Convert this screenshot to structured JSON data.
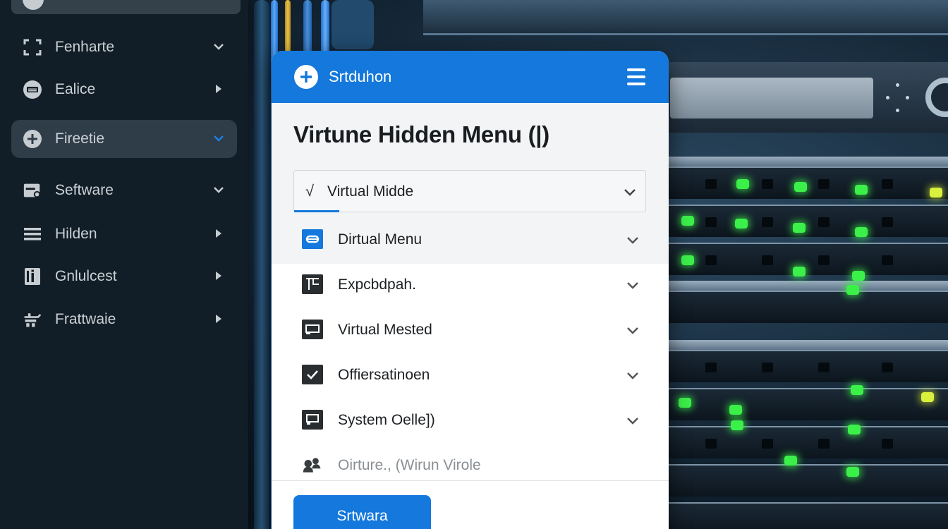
{
  "sidebar": {
    "items": [
      {
        "label": "Fenharte",
        "icon": "frame-icon",
        "indicator": "chevron-down"
      },
      {
        "label": "Ealice",
        "icon": "keyboard-icon",
        "indicator": "caret-right"
      },
      {
        "label": "Fireetie",
        "icon": "plus-circle-icon",
        "indicator": "chevron-down",
        "active": true
      },
      {
        "label": "Seftware",
        "icon": "calendar-icon",
        "indicator": "chevron-down"
      },
      {
        "label": "Hilden",
        "icon": "list-icon",
        "indicator": "caret-right"
      },
      {
        "label": "Gnlulcest",
        "icon": "info-card-icon",
        "indicator": "caret-right"
      },
      {
        "label": "Frattwaie",
        "icon": "tools-icon",
        "indicator": "caret-right"
      }
    ]
  },
  "panel": {
    "header_title": "Srtduhon",
    "heading": "Virtune Hidden Menu (|)",
    "select": {
      "check": "√",
      "value": "Virtual Midde"
    },
    "items": [
      {
        "label": "Dirtual Menu",
        "icon": "window-icon"
      },
      {
        "label": "Expcbdpah.",
        "icon": "terminal-icon"
      },
      {
        "label": "Virtual Mested",
        "icon": "card-icon"
      },
      {
        "label": "Offiersatinoen",
        "icon": "check-box-icon"
      },
      {
        "label": "System Oelle])",
        "icon": "display-icon"
      }
    ],
    "footer_item": "Oirture., (Wirun Virole",
    "button_label": "Srtwara"
  },
  "colors": {
    "accent": "#1478dc",
    "sidebar_bg": "#121e27",
    "sidebar_active": "#2f3d48",
    "led_green": "#3cf04a"
  }
}
